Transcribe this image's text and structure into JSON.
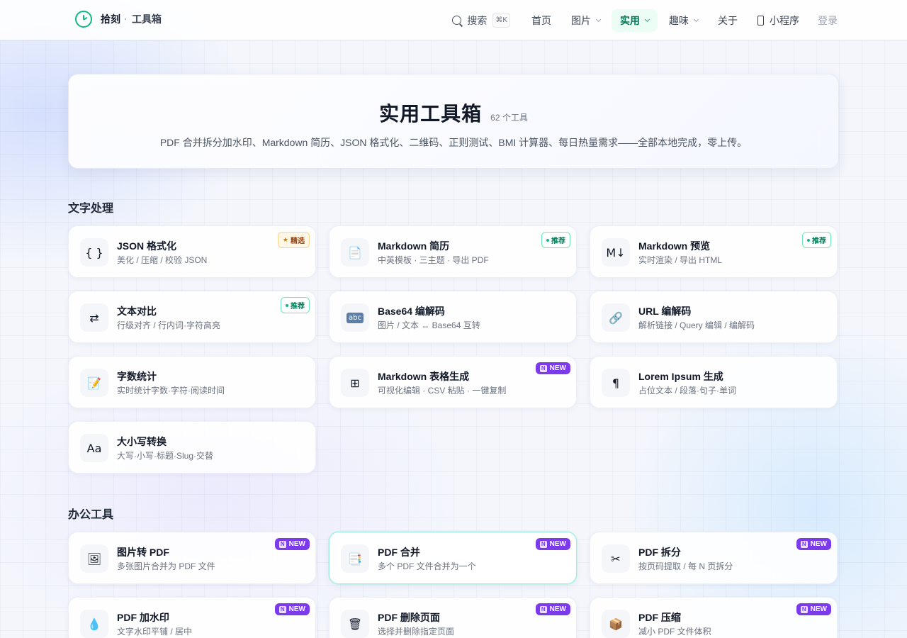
{
  "nav": {
    "brand_name": "拾刻",
    "brand_sub": "工具箱",
    "search_label": "搜索",
    "search_shortcut": "⌘K",
    "links": [
      {
        "label": "首页",
        "dropdown": false,
        "active": false
      },
      {
        "label": "图片",
        "dropdown": true,
        "active": false
      },
      {
        "label": "实用",
        "dropdown": true,
        "active": true
      },
      {
        "label": "趣味",
        "dropdown": true,
        "active": false
      },
      {
        "label": "关于",
        "dropdown": false,
        "active": false
      }
    ],
    "miniprogram_label": "小程序",
    "login_label": "登录"
  },
  "hero": {
    "title": "实用工具箱",
    "count": "62 个工具",
    "description": "PDF 合并拆分加水印、Markdown 简历、JSON 格式化、二维码、正则测试、BMI 计算器、每日热量需求——全部本地完成，零上传。"
  },
  "sections": [
    {
      "title": "文字处理",
      "tools": [
        {
          "icon": "{ }",
          "icon_name": "braces-icon",
          "title": "JSON 格式化",
          "desc": "美化 / 压缩 / 校验 JSON",
          "badge": "精选",
          "badge_type": "featured"
        },
        {
          "icon": "📄",
          "icon_name": "document-icon",
          "title": "Markdown 简历",
          "desc": "中英模板 · 三主题 · 导出 PDF",
          "badge": "推荐",
          "badge_type": "recommend"
        },
        {
          "icon": "M↓",
          "icon_name": "markdown-icon",
          "title": "Markdown 预览",
          "desc": "实时渲染 / 导出 HTML",
          "badge": "推荐",
          "badge_type": "recommend"
        },
        {
          "icon": "⇄",
          "icon_name": "compare-arrows-icon",
          "title": "文本对比",
          "desc": "行级对齐 / 行内词·字符高亮",
          "badge": "推荐",
          "badge_type": "recommend"
        },
        {
          "icon": "abc",
          "icon_name": "abc-icon",
          "title": "Base64 编解码",
          "desc": "图片 / 文本 ↔ Base64 互转",
          "badge": "",
          "badge_type": ""
        },
        {
          "icon": "🔗",
          "icon_name": "link-icon",
          "title": "URL 编解码",
          "desc": "解析链接 / Query 编辑 / 编解码",
          "badge": "",
          "badge_type": ""
        },
        {
          "icon": "📝",
          "icon_name": "memo-icon",
          "title": "字数统计",
          "desc": "实时统计字数·字符·阅读时间",
          "badge": "",
          "badge_type": ""
        },
        {
          "icon": "⊞",
          "icon_name": "table-grid-icon",
          "title": "Markdown 表格生成",
          "desc": "可视化编辑 · CSV 粘贴 · 一键复制",
          "badge": "NEW",
          "badge_type": "new"
        },
        {
          "icon": "¶",
          "icon_name": "pilcrow-icon",
          "title": "Lorem Ipsum 生成",
          "desc": "占位文本 / 段落·句子·单词",
          "badge": "",
          "badge_type": ""
        },
        {
          "icon": "Aa",
          "icon_name": "letter-case-icon",
          "title": "大小写转换",
          "desc": "大写·小写·标题·Slug·交替",
          "badge": "",
          "badge_type": ""
        }
      ]
    },
    {
      "title": "办公工具",
      "tools": [
        {
          "icon": "🖼",
          "icon_name": "picture-icon",
          "title": "图片转 PDF",
          "desc": "多张图片合并为 PDF 文件",
          "badge": "NEW",
          "badge_type": "new"
        },
        {
          "icon": "📑",
          "icon_name": "merge-pdf-icon",
          "title": "PDF 合并",
          "desc": "多个 PDF 文件合并为一个",
          "badge": "NEW",
          "badge_type": "new"
        },
        {
          "icon": "✂",
          "icon_name": "scissors-icon",
          "title": "PDF 拆分",
          "desc": "按页码提取 / 每 N 页拆分",
          "badge": "NEW",
          "badge_type": "new"
        },
        {
          "icon": "💧",
          "icon_name": "droplet-icon",
          "title": "PDF 加水印",
          "desc": "文字水印平铺 / 居中",
          "badge": "NEW",
          "badge_type": "new"
        },
        {
          "icon": "🗑",
          "icon_name": "trash-icon",
          "title": "PDF 删除页面",
          "desc": "选择并删除指定页面",
          "badge": "NEW",
          "badge_type": "new"
        },
        {
          "icon": "📦",
          "icon_name": "package-icon",
          "title": "PDF 压缩",
          "desc": "减小 PDF 文件体积",
          "badge": "NEW",
          "badge_type": "new"
        }
      ]
    }
  ]
}
